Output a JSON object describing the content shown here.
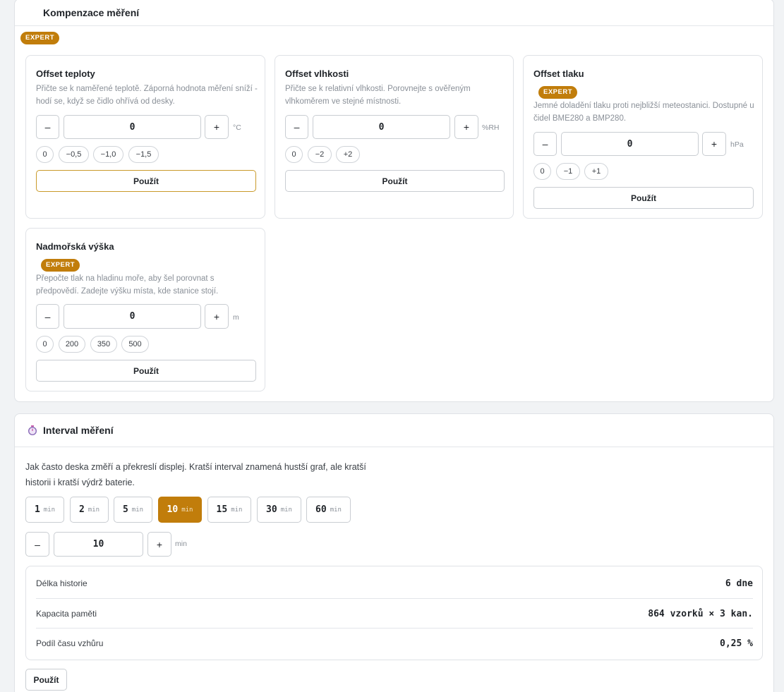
{
  "compensation": {
    "title": "Kompenzace měření",
    "expert_badge": "EXPERT",
    "cards": {
      "temperature": {
        "title": "Offset teploty",
        "desc": "Přičte se k naměřené teplotě. Záporná hodnota měření sníží - hodí se, když se čidlo ohřívá od desky.",
        "value": "0",
        "unit": "°C",
        "minus": "–",
        "plus": "+",
        "chips": [
          "0",
          "−0,5",
          "−1,0",
          "−1,5"
        ],
        "apply": "Použít"
      },
      "humidity": {
        "title": "Offset vlhkosti",
        "desc": "Přičte se k relativní vlhkosti. Porovnejte s ověřeným vlhkoměrem ve stejné místnosti.",
        "value": "0",
        "unit": "%RH",
        "minus": "–",
        "plus": "+",
        "chips": [
          "0",
          "−2",
          "+2"
        ],
        "apply": "Použít"
      },
      "pressure": {
        "title": "Offset tlaku",
        "badge": "EXPERT",
        "desc": "Jemné doladění tlaku proti nejbližší meteostanici. Dostupné u čidel BME280 a BMP280.",
        "value": "0",
        "unit": "hPa",
        "minus": "–",
        "plus": "+",
        "chips": [
          "0",
          "−1",
          "+1"
        ],
        "apply": "Použít"
      },
      "altitude": {
        "title": "Nadmořská výška",
        "badge": "EXPERT",
        "desc": "Přepočte tlak na hladinu moře, aby šel porovnat s předpovědí. Zadejte výšku místa, kde stanice stojí.",
        "value": "0",
        "unit": "m",
        "minus": "–",
        "plus": "+",
        "chips": [
          "0",
          "200",
          "350",
          "500"
        ],
        "apply": "Použít"
      }
    }
  },
  "interval": {
    "title": "Interval měření",
    "desc_line1": "Jak často deska změří a překreslí displej. Kratší interval znamená hustší graf, ale kratší",
    "desc_line2": "historii i kratší výdrž baterie.",
    "options": [
      {
        "num": "1",
        "unit": "min"
      },
      {
        "num": "2",
        "unit": "min"
      },
      {
        "num": "5",
        "unit": "min"
      },
      {
        "num": "10",
        "unit": "min"
      },
      {
        "num": "15",
        "unit": "min"
      },
      {
        "num": "30",
        "unit": "min"
      },
      {
        "num": "60",
        "unit": "min"
      }
    ],
    "selected": "10",
    "value": "10",
    "unit": "min",
    "minus": "–",
    "plus": "+",
    "stats": [
      {
        "label": "Délka historie",
        "value": "6 dne"
      },
      {
        "label": "Kapacita paměti",
        "value": "864 vzorků × 3 kan."
      },
      {
        "label": "Podíl času vzhůru",
        "value": "0,25 %"
      }
    ],
    "apply": "Použít"
  },
  "colors": {
    "accent": "#c17d0b",
    "border": "#dfe2e6",
    "muted": "#8a9098"
  }
}
